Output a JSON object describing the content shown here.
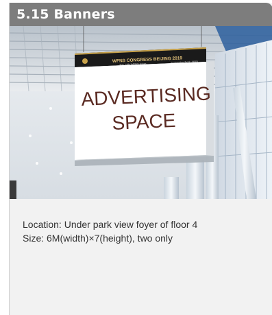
{
  "card": {
    "title": "5.15 Banners",
    "photo": {
      "banner_strip_title": "WFNS CONGRESS BEIJING 2019",
      "banner_strip_subtitle": "The 14th WFNS Asian",
      "banner_strip_date": "September 9-12, 2019",
      "banner_main_line1": "ADVERTISING",
      "banner_main_line2": "SPACE"
    },
    "location_text": "Location: Under park view foyer of floor 4",
    "size_text": "Size: 6M(width)×7(height), two only"
  },
  "colors": {
    "header_bg": "#7d7d7d",
    "card_bg": "#f2f2f2",
    "banner_strip": "#1a1a1a",
    "banner_text": "#5a2a22",
    "ceiling_accent": "#2d5f9e"
  }
}
